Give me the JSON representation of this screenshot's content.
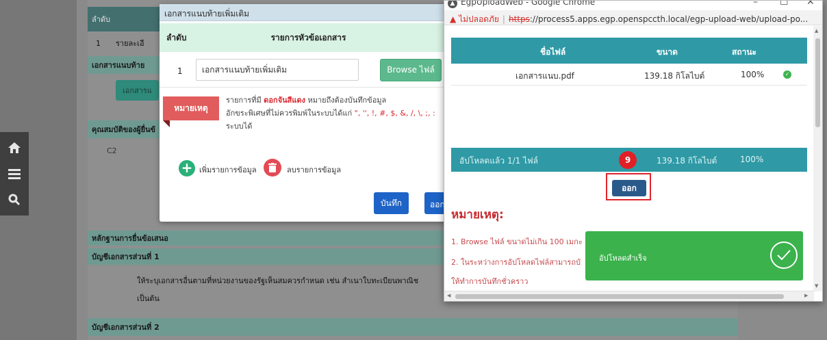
{
  "background": {
    "table_header_order": "ลำดับ",
    "row1_num": "1",
    "row1_text": "รายละเอี",
    "attach_section": "เอกสารแนบท้าย",
    "attach_button": "เอกสารแ",
    "qualification_section": "คุณสมบัติของผู้ยื่นข้",
    "code_c2": "C2",
    "evidence_section": "หลักฐานการยื่นข้อเสนอ",
    "doc_list_1": "บัญชีเอกสารส่วนที่ 1",
    "doc_list_1_desc": "ให้ระบุเอกสารอื่นตามที่หน่วยงานของรัฐเห็นสมควรกำหนด เช่น สำเนาใบทะเบียนพาณิช",
    "doc_list_1_desc2": "เป็นต้น",
    "doc_list_2": "บัญชีเอกสารส่วนที่ 2"
  },
  "sidenav": {
    "icons": [
      "home-icon",
      "menu-icon",
      "search-icon"
    ]
  },
  "modal": {
    "title": "เอกสารแนบท้ายเพิ่มเติม",
    "col_order": "ลำดับ",
    "col_items": "รายการหัวข้อเอกสาร",
    "row_num": "1",
    "row_value": "เอกสารแนบท้ายเพิ่มเติม",
    "browse_label": "Browse ไฟล์",
    "note_label": "หมายเหตุ",
    "note_line1_a": "รายการที่มี ",
    "note_line1_red": "ดอกจันสีแดง",
    "note_line1_b": " หมายถึงต้องบันทึกข้อมูล",
    "note_line2": "อักขระพิเศษที่ไม่ควรพิมพ์ในระบบได้แก่ ",
    "note_line2_chars": "\", '', !, #, $, &, /, \\, ;, :",
    "note_line3": "ระบบได้",
    "add_label": "เพิ่มรายการข้อมูล",
    "delete_label": "ลบรายการข้อมูล",
    "save_label": "บันทึก",
    "exit_label": "ออก"
  },
  "window": {
    "title": "EgpUploadWeb - Google Chrome",
    "minimize": "–",
    "maximize": "☐",
    "close": "✕",
    "security_label": "ไม่ปลอดภัย",
    "url_scheme": "https",
    "url_rest": "://process5.apps.egp.openspccth.local/egp-upload-web/upload-po..."
  },
  "upload": {
    "col_filename": "ชื่อไฟล์",
    "col_size": "ขนาด",
    "col_status": "สถานะ",
    "files": [
      {
        "name": "เอกสารแนบ.pdf",
        "size": "139.18 กิโลไบต์",
        "status": "100%"
      }
    ],
    "summary_count": "อัปโหลดแล้ว 1/1 ไฟล์",
    "summary_size": "139.18 กิโลไบต์",
    "summary_pct": "100%",
    "step_number": "9",
    "exit_label": "ออก",
    "remark_title": "หมายเหตุ:",
    "remark_1": "1. Browse ไฟล์ ขนาดไม่เกิน 100 เมกะ",
    "remark_2": "2. ในระหว่างการอัปโหลดไฟล์สามารถบั",
    "remark_3": "ให้ทำการบันทึกชั่วคราว",
    "toast_message": "อัปโหลดสำเร็จ"
  }
}
